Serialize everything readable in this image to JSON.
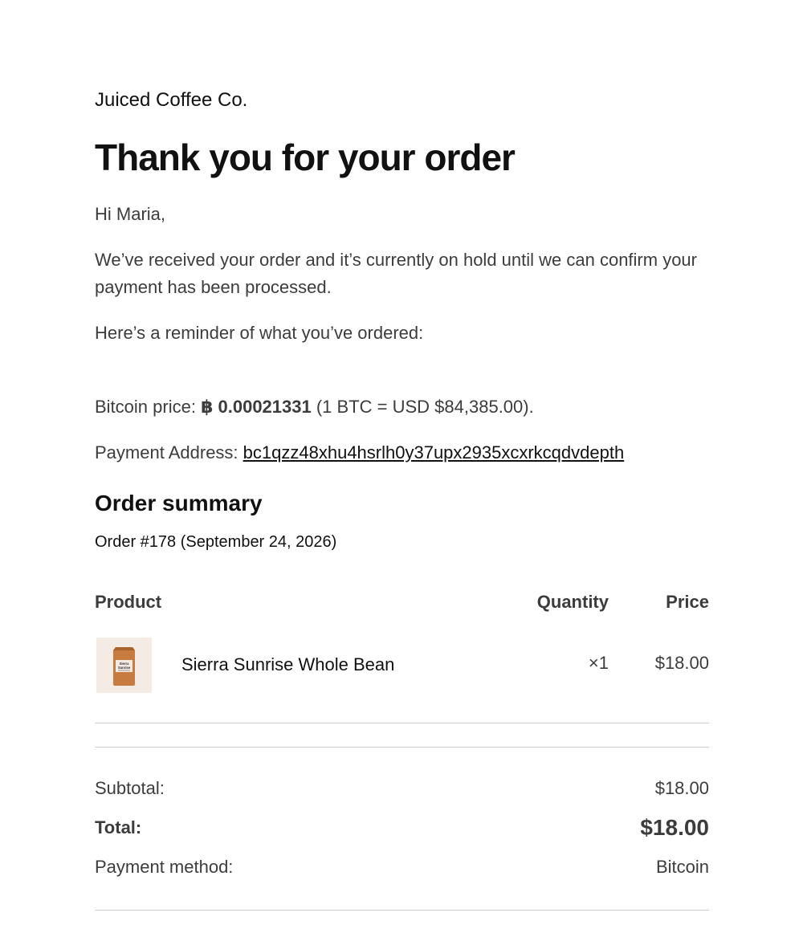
{
  "store": {
    "name": "Juiced Coffee Co."
  },
  "email": {
    "heading": "Thank you for your order",
    "greeting": "Hi Maria,",
    "received_text": "We’ve received your order and it’s currently on hold until we can confirm your payment has been processed.",
    "reminder_text": "Here’s a reminder of what you’ve ordered:"
  },
  "payment_info": {
    "bitcoin_price_label": "Bitcoin price:",
    "bitcoin_amount": "฿ 0.00021331",
    "exchange_rate_text": "(1 BTC = USD $84,385.00).",
    "address_label": "Payment Address:",
    "address": "bc1qzz48xhu4hsrlh0y37upx2935xcxrkcqdvdepth"
  },
  "order_summary": {
    "title": "Order summary",
    "order_meta": "Order #178 (September 24, 2026)",
    "columns": {
      "product": "Product",
      "quantity": "Quantity",
      "price": "Price"
    },
    "items": [
      {
        "name": "Sierra Sunrise Whole Bean",
        "quantity": "×1",
        "price": "$18.00",
        "thumbnail_label_line1": "Sierra",
        "thumbnail_label_line2": "Sunrise",
        "thumbnail_icon": "coffee-bag-icon"
      }
    ],
    "subtotal_label": "Subtotal:",
    "subtotal_value": "$18.00",
    "total_label": "Total:",
    "total_value": "$18.00",
    "payment_method_label": "Payment method:",
    "payment_method_value": "Bitcoin"
  },
  "colors": {
    "heading_text": "#111111",
    "body_text": "#3c3c3c",
    "divider": "#cfcfcf",
    "thumbnail_background": "#f4ebe4",
    "coffee_bag": "#c87b3e"
  }
}
